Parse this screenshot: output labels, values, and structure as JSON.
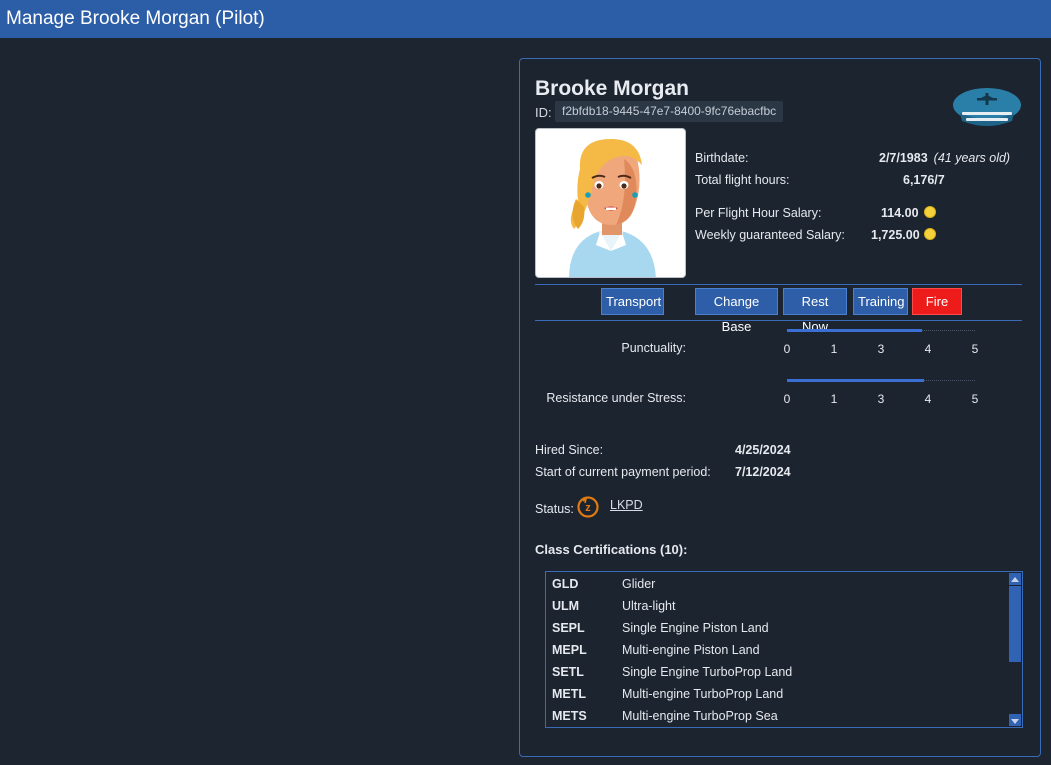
{
  "window": {
    "title": "Manage Brooke Morgan (Pilot)"
  },
  "pilot": {
    "name": "Brooke Morgan",
    "id_label": "ID:",
    "id": "f2bfdb18-9445-47e7-8400-9fc76ebacfbc",
    "birthdate_label": "Birthdate:",
    "birthdate": "2/7/1983",
    "age": "(41 years old)",
    "flight_hours_label": "Total flight hours:",
    "flight_hours": "6,176/7",
    "hour_salary_label": "Per Flight Hour Salary:",
    "hour_salary": "114.00",
    "weekly_salary_label": "Weekly guaranteed Salary:",
    "weekly_salary": "1,725.00"
  },
  "actions": {
    "transport": "Transport",
    "change_base": "Change Base",
    "rest_now": "Rest Now",
    "training": "Training",
    "fire": "Fire"
  },
  "skills": [
    {
      "label": "Punctuality:",
      "value": 3.6
    },
    {
      "label": "Resistance under Stress:",
      "value": 3.65
    }
  ],
  "scale_ticks": [
    "0",
    "1",
    "3",
    "4",
    "5"
  ],
  "employment": {
    "hired_label": "Hired Since:",
    "hired": "4/25/2024",
    "period_label": "Start of current payment period:",
    "period": "7/12/2024",
    "status_label": "Status:",
    "status_location": "LKPD"
  },
  "certifications": {
    "title": "Class Certifications (10):",
    "items": [
      {
        "code": "GLD",
        "name": "Glider"
      },
      {
        "code": "ULM",
        "name": "Ultra-light"
      },
      {
        "code": "SEPL",
        "name": "Single Engine Piston Land"
      },
      {
        "code": "MEPL",
        "name": "Multi-engine Piston Land"
      },
      {
        "code": "SETL",
        "name": "Single Engine TurboProp Land"
      },
      {
        "code": "METL",
        "name": "Multi-engine TurboProp Land"
      },
      {
        "code": "METS",
        "name": "Multi-engine TurboProp Sea"
      }
    ]
  },
  "colors": {
    "titlebar": "#2c5ea8",
    "background": "#1d2530",
    "accent": "#3a6ab8",
    "fire": "#ee1b1b",
    "coin": "#f5d23b",
    "status_icon": "#e07a10",
    "cap": "#2a7fa8"
  },
  "icons": {
    "cap": "pilot-cap-icon",
    "coin": "coin-icon",
    "status": "resting-status-icon"
  }
}
